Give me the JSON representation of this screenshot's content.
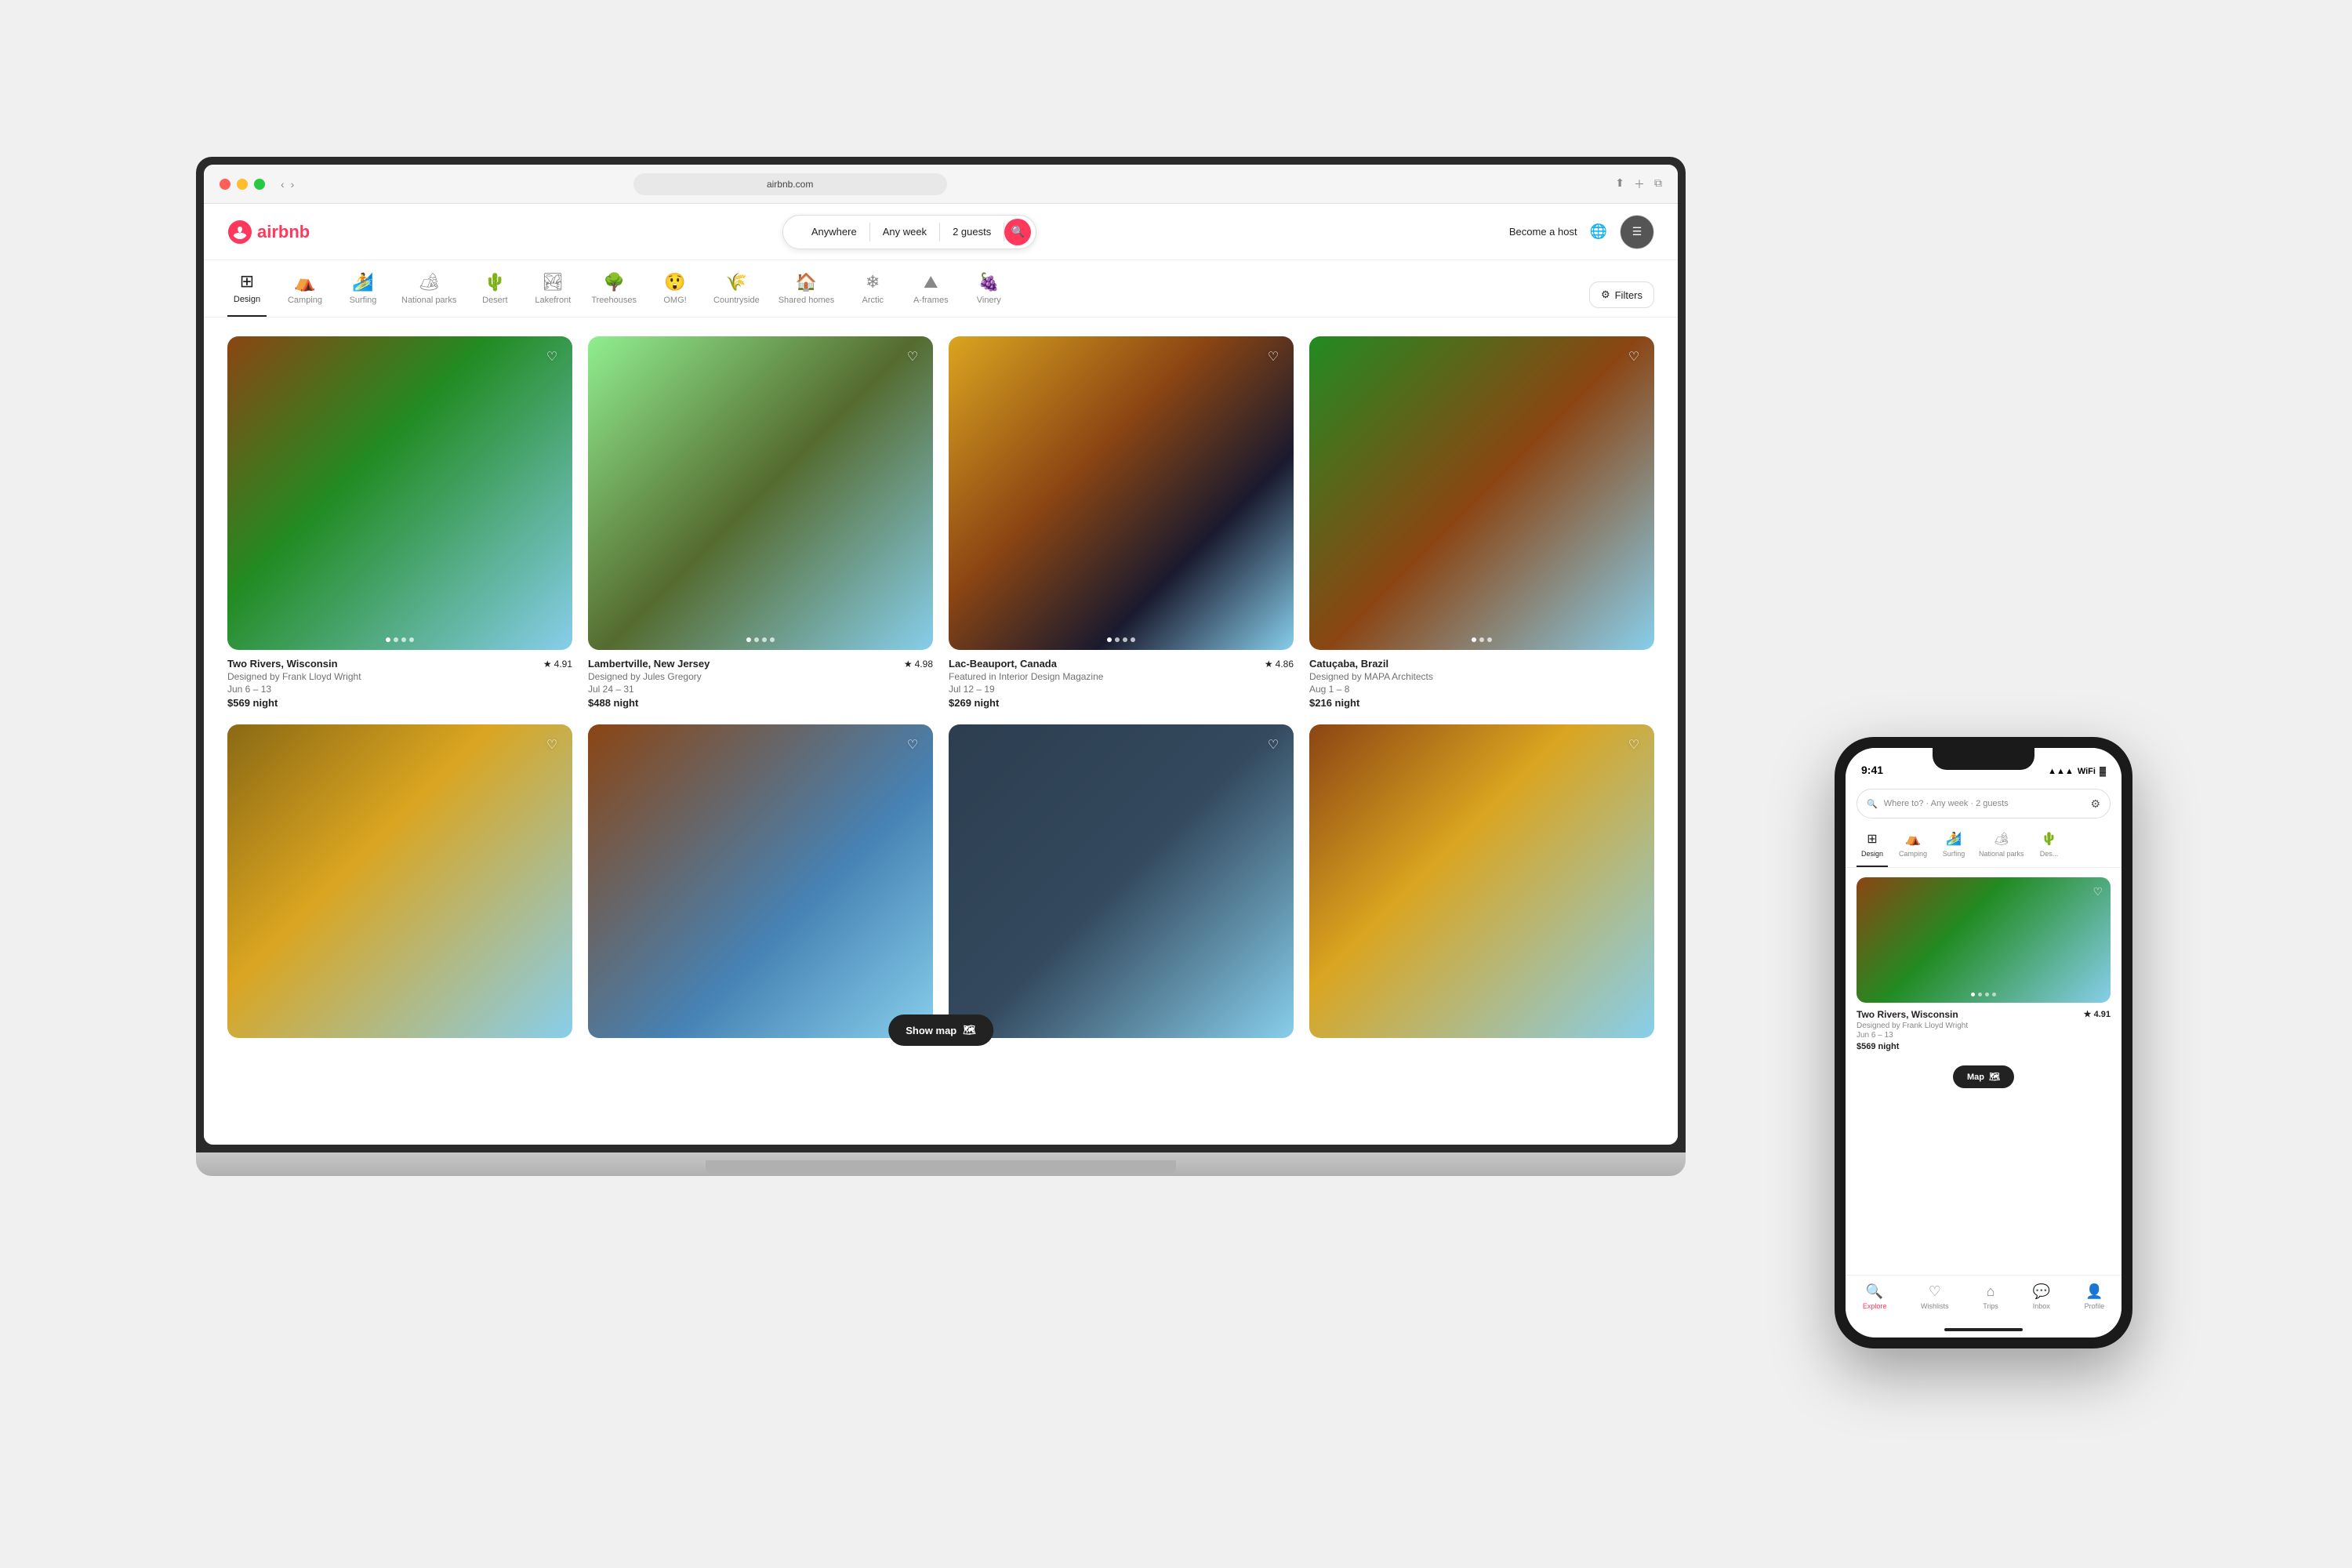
{
  "browser": {
    "url": "airbnb.com",
    "traffic_lights": [
      "red",
      "yellow",
      "green"
    ]
  },
  "airbnb": {
    "logo_text": "airbnb",
    "search": {
      "anywhere": "Anywhere",
      "any_week": "Any week",
      "guests": "2 guests"
    },
    "header": {
      "become_host": "Become a host"
    },
    "categories": [
      {
        "id": "design",
        "label": "Design",
        "icon": "⊞",
        "active": true
      },
      {
        "id": "camping",
        "label": "Camping",
        "icon": "⛺"
      },
      {
        "id": "surfing",
        "label": "Surfing",
        "icon": "🏄"
      },
      {
        "id": "national_parks",
        "label": "National parks",
        "icon": "🏕"
      },
      {
        "id": "desert",
        "label": "Desert",
        "icon": "🌵"
      },
      {
        "id": "lakefront",
        "label": "Lakefront",
        "icon": "🏞"
      },
      {
        "id": "treehouses",
        "label": "Treehouses",
        "icon": "🌳"
      },
      {
        "id": "omg",
        "label": "OMG!",
        "icon": "😲"
      },
      {
        "id": "countryside",
        "label": "Countryside",
        "icon": "🌾"
      },
      {
        "id": "shared_homes",
        "label": "Shared homes",
        "icon": "🏠"
      },
      {
        "id": "arctic",
        "label": "Arctic",
        "icon": "❄"
      },
      {
        "id": "aframes",
        "label": "A-frames",
        "icon": "⛰"
      },
      {
        "id": "vineyards",
        "label": "Vinery",
        "icon": "🍇"
      }
    ],
    "filters_label": "Filters",
    "listings": [
      {
        "id": 1,
        "location": "Two Rivers, Wisconsin",
        "rating": "4.91",
        "description": "Designed by Frank Lloyd Wright",
        "dates": "Jun 6 – 13",
        "price": "$569 night",
        "img_class": "img-house1"
      },
      {
        "id": 2,
        "location": "Lambertville, New Jersey",
        "rating": "4.98",
        "description": "Designed by Jules Gregory",
        "dates": "Jul 24 – 31",
        "price": "$488 night",
        "img_class": "img-house2"
      },
      {
        "id": 3,
        "location": "Lac-Beauport, Canada",
        "rating": "4.86",
        "description": "Featured in Interior Design Magazine",
        "dates": "Jul 12 – 19",
        "price": "$269 night",
        "img_class": "img-house3"
      },
      {
        "id": 4,
        "location": "Catuçaba, Brazil",
        "rating": "",
        "description": "Designed by MAPA Architects",
        "dates": "Aug 1 – 8",
        "price": "$216 night",
        "img_class": "img-house4"
      },
      {
        "id": 5,
        "location": "",
        "rating": "",
        "description": "",
        "dates": "",
        "price": "",
        "img_class": "img-house5"
      },
      {
        "id": 6,
        "location": "",
        "rating": "",
        "description": "",
        "dates": "",
        "price": "",
        "img_class": "img-house6"
      },
      {
        "id": 7,
        "location": "",
        "rating": "",
        "description": "",
        "dates": "",
        "price": "",
        "img_class": "img-house7"
      },
      {
        "id": 8,
        "location": "",
        "rating": "",
        "description": "",
        "dates": "",
        "price": "",
        "img_class": "img-house8"
      }
    ],
    "show_map_label": "Show map"
  },
  "phone": {
    "time": "9:41",
    "search_placeholder": "Where to?  ·  Any week  ·  2 guests",
    "categories": [
      {
        "label": "Design",
        "icon": "⊞",
        "active": true
      },
      {
        "label": "Camping",
        "icon": "⛺"
      },
      {
        "label": "Surfing",
        "icon": "🏄"
      },
      {
        "label": "National parks",
        "icon": "🏕"
      },
      {
        "label": "Des...",
        "icon": "🌵"
      }
    ],
    "listing": {
      "location": "Two Rivers, Wisconsin",
      "rating": "4.91",
      "description": "Designed by Frank Lloyd Wright",
      "dates": "Jun 6 – 13",
      "price": "$569 night"
    },
    "map_label": "Map",
    "bottom_nav": [
      {
        "label": "Explore",
        "icon": "🔍",
        "active": true
      },
      {
        "label": "Wishlists",
        "icon": "♡"
      },
      {
        "label": "Trips",
        "icon": "⊙"
      },
      {
        "label": "Inbox",
        "icon": "💬"
      },
      {
        "label": "Profile",
        "icon": "👤"
      }
    ]
  }
}
